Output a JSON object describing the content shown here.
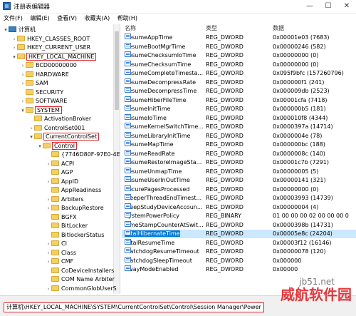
{
  "window": {
    "title": "注册表编辑器",
    "min": "—",
    "max": "☐",
    "close": "✕"
  },
  "menu": [
    "文件(F)",
    "编辑(E)",
    "查看(V)",
    "收藏夹(A)",
    "帮助(H)"
  ],
  "tree": [
    {
      "label": "计算机",
      "arrow": "▾",
      "icon": "pc",
      "indent": 0
    },
    {
      "label": "HKEY_CLASSES_ROOT",
      "arrow": "›",
      "icon": "folder",
      "indent": 1
    },
    {
      "label": "HKEY_CURRENT_USER",
      "arrow": "›",
      "icon": "folder",
      "indent": 1
    },
    {
      "label": "HKEY_LOCAL_MACHINE",
      "arrow": "▾",
      "icon": "folder",
      "indent": 1,
      "highlight": true
    },
    {
      "label": "BCD00000000",
      "arrow": "›",
      "icon": "folder",
      "indent": 2
    },
    {
      "label": "HARDWARE",
      "arrow": "›",
      "icon": "folder",
      "indent": 2
    },
    {
      "label": "SAM",
      "arrow": "›",
      "icon": "folder",
      "indent": 2
    },
    {
      "label": "SECURITY",
      "arrow": "",
      "icon": "folder",
      "indent": 2
    },
    {
      "label": "SOFTWARE",
      "arrow": "›",
      "icon": "folder",
      "indent": 2
    },
    {
      "label": "SYSTEM",
      "arrow": "▾",
      "icon": "folder",
      "indent": 2,
      "highlight": true
    },
    {
      "label": "ActivationBroker",
      "arrow": "",
      "icon": "folder",
      "indent": 3
    },
    {
      "label": "ControlSet001",
      "arrow": "›",
      "icon": "folder",
      "indent": 3
    },
    {
      "label": "CurrentControlSet",
      "arrow": "▾",
      "icon": "folder",
      "indent": 3,
      "highlight": true
    },
    {
      "label": "Control",
      "arrow": "▾",
      "icon": "folder",
      "indent": 4,
      "highlight": true
    },
    {
      "label": "{7746D80F-97E0-4E",
      "arrow": "",
      "icon": "folder",
      "indent": 5
    },
    {
      "label": "ACPI",
      "arrow": "›",
      "icon": "folder",
      "indent": 5
    },
    {
      "label": "AGP",
      "arrow": "",
      "icon": "folder",
      "indent": 5
    },
    {
      "label": "AppID",
      "arrow": "›",
      "icon": "folder",
      "indent": 5
    },
    {
      "label": "AppReadiness",
      "arrow": "",
      "icon": "folder",
      "indent": 5
    },
    {
      "label": "Arbiters",
      "arrow": "›",
      "icon": "folder",
      "indent": 5
    },
    {
      "label": "BackupRestore",
      "arrow": "›",
      "icon": "folder",
      "indent": 5
    },
    {
      "label": "BGFX",
      "arrow": "",
      "icon": "folder",
      "indent": 5
    },
    {
      "label": "BitLocker",
      "arrow": "",
      "icon": "folder",
      "indent": 5
    },
    {
      "label": "BitlockerStatus",
      "arrow": "",
      "icon": "folder",
      "indent": 5
    },
    {
      "label": "CI",
      "arrow": "›",
      "icon": "folder",
      "indent": 5
    },
    {
      "label": "Class",
      "arrow": "›",
      "icon": "folder",
      "indent": 5
    },
    {
      "label": "CMF",
      "arrow": "›",
      "icon": "folder",
      "indent": 5
    },
    {
      "label": "CoDeviceInstallers",
      "arrow": "",
      "icon": "folder",
      "indent": 5
    },
    {
      "label": "COM Name Arbiter",
      "arrow": "",
      "icon": "folder",
      "indent": 5
    },
    {
      "label": "CommonGlobUserS",
      "arrow": "›",
      "icon": "folder",
      "indent": 5
    }
  ],
  "columns": {
    "name": "名称",
    "type": "类型",
    "data": "数据"
  },
  "values": [
    {
      "name": "ResumeAppTime",
      "type": "REG_DWORD",
      "data": "0x00001e03 (7683)"
    },
    {
      "name": "ResumeBootMgrTime",
      "type": "REG_DWORD",
      "data": "0x00000246 (582)"
    },
    {
      "name": "ResumeChecksumIoTime",
      "type": "REG_DWORD",
      "data": "0x00000000 (0)"
    },
    {
      "name": "ResumeChecksumTime",
      "type": "REG_DWORD",
      "data": "0x00000000 (0)"
    },
    {
      "name": "ResumeCompleteTimesta...",
      "type": "REG_QWORD",
      "data": "0x095f9bfc (157260796)"
    },
    {
      "name": "ResumeDecompressRate",
      "type": "REG_DWORD",
      "data": "0x000000f1 (241)"
    },
    {
      "name": "ResumeDecompressTime",
      "type": "REG_DWORD",
      "data": "0x000009db (2523)"
    },
    {
      "name": "ResumeHiberFileTime",
      "type": "REG_DWORD",
      "data": "0x00001cfa (7418)"
    },
    {
      "name": "ResumeInitTime",
      "type": "REG_DWORD",
      "data": "0x000000b5 (181)"
    },
    {
      "name": "ResumeIoTime",
      "type": "REG_DWORD",
      "data": "0x000010f8 (4344)"
    },
    {
      "name": "ResumeKernelSwitchTime...",
      "type": "REG_DWORD",
      "data": "0x0000397a (14714)"
    },
    {
      "name": "ResumeLibraryInitTime",
      "type": "REG_DWORD",
      "data": "0x0000004e (78)"
    },
    {
      "name": "ResumeMapTime",
      "type": "REG_DWORD",
      "data": "0x000000bc (188)"
    },
    {
      "name": "ResumeReadRate",
      "type": "REG_DWORD",
      "data": "0x0000008c (140)"
    },
    {
      "name": "ResumeRestoreImageSta...",
      "type": "REG_DWORD",
      "data": "0x00001c7b (7291)"
    },
    {
      "name": "ResumeUnmapTime",
      "type": "REG_DWORD",
      "data": "0x00000005 (5)"
    },
    {
      "name": "ResumeUserInOutTime",
      "type": "REG_DWORD",
      "data": "0x00000141 (321)"
    },
    {
      "name": "SecurePagesProcessed",
      "type": "REG_DWORD",
      "data": "0x00000000 (0)"
    },
    {
      "name": "SleeperThreadEndTimest...",
      "type": "REG_DWORD",
      "data": "0x00003993 (14739)"
    },
    {
      "name": "SleepStudyDeviceAccoun...",
      "type": "REG_DWORD",
      "data": "0x00000004 (4)"
    },
    {
      "name": "SystemPowerPolicy",
      "type": "REG_BINARY",
      "data": "01 00 00 00 02 00 00 00 0"
    },
    {
      "name": "TimeStampCounterAtSwit...",
      "type": "REG_DWORD",
      "data": "0x0000398b (14731)"
    },
    {
      "name": "TotalHibernateTime",
      "type": "REG_DWORD",
      "data": "0x00005e8c (24204)",
      "selected": true
    },
    {
      "name": "TotalResumeTime",
      "type": "REG_DWORD",
      "data": "0x00003f12 (16146)"
    },
    {
      "name": "WatchdogResumeTimeout",
      "type": "REG_DWORD",
      "data": "0x00000078 (120)"
    },
    {
      "name": "WatchdogSleepTimeout",
      "type": "REG_DWORD",
      "data": "0x000000"
    },
    {
      "name": "AwayModeEnabled",
      "type": "REG_DWORD",
      "data": "0x00000"
    }
  ],
  "status": {
    "path": "计算机\\HKEY_LOCAL_MACHINE\\SYSTEM\\CurrentControlSet\\Control\\Session Manager\\Power"
  },
  "watermark": {
    "text": "威航软件园",
    "sub": "jb51.net"
  },
  "colors": {
    "selection": "#0078d7",
    "highlight_box": "#e0262b",
    "folder": "#f3cf64"
  }
}
